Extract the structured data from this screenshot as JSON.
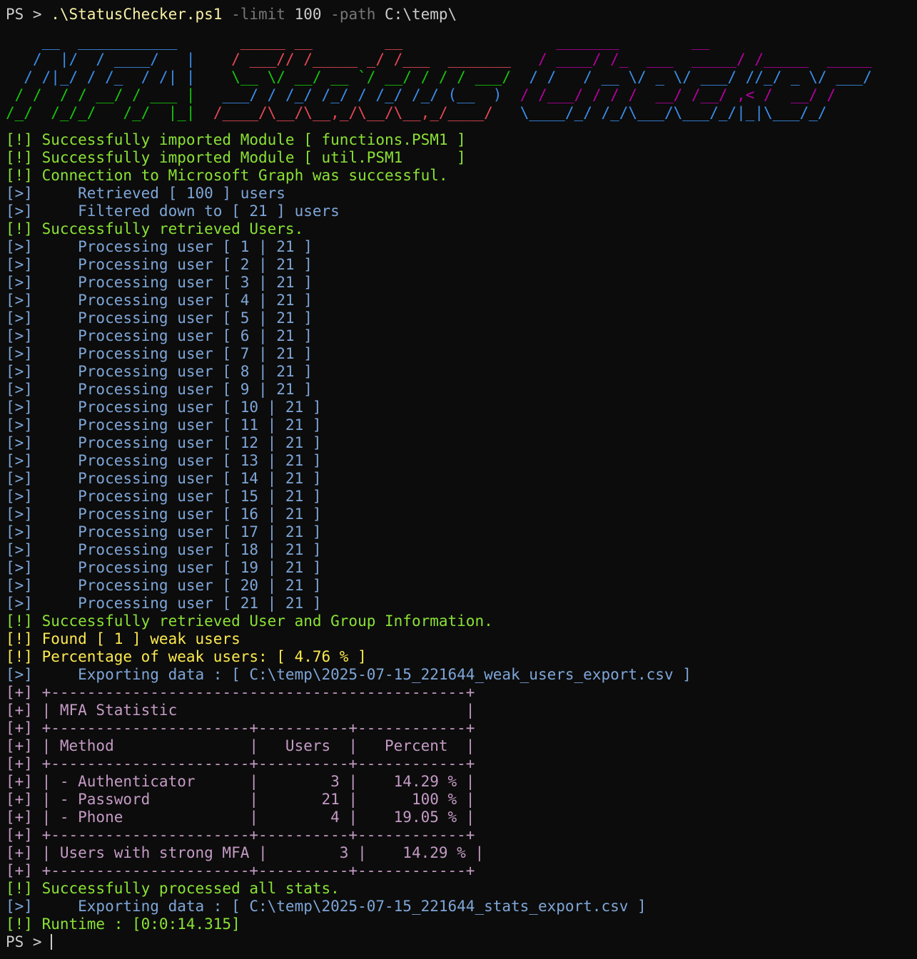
{
  "prompt": {
    "ps": "PS > ",
    "script": ".\\StatusChecker.ps1",
    "arg1_flag": " -limit",
    "arg1_value": " 100",
    "arg2_flag": " -path",
    "arg2_value": " C:\\temp\\",
    "final_ps": "PS > "
  },
  "banner": {
    "lines": [
      [
        {
          "text": "    __  ___________   ",
          "color": "#3b8eea"
        },
        {
          "text": "    ",
          "color": "#cccccc"
        },
        {
          "text": "_____ __        __                 ",
          "color": "#e74856"
        },
        {
          "text": "_______        __",
          "color": "#b4009e"
        }
      ],
      [
        {
          "text": "   /  |/  / ____/   |",
          "color": "#3b8eea"
        },
        {
          "text": "    ",
          "color": "#cccccc"
        },
        {
          "text": "/ ___// /_____ _/ /___  _______   ",
          "color": "#e74856"
        },
        {
          "text": "/ ____/ /_  ___  _____/ /_____  _____",
          "color": "#b4009e"
        }
      ],
      [
        {
          "text": "  / /|_/ / /_  / /| |",
          "color": "#3b8eea"
        },
        {
          "text": "    ",
          "color": "#cccccc"
        },
        {
          "text": "\\__ \\/ __/ __ `/ __/ / / / ___/  ",
          "color": "#16c60c"
        },
        {
          "text": "/ /   / __ \\/ _ \\/ ___/ //_/ _ \\/ ___/",
          "color": "#3b8eea"
        }
      ],
      [
        {
          "text": " / /  / / __/ / ___ |",
          "color": "#16c60c"
        },
        {
          "text": "   ",
          "color": "#cccccc"
        },
        {
          "text": "___/ / /_/ /_/ / /_/ /_/ (__  )  ",
          "color": "#3b8eea"
        },
        {
          "text": "/ /___/ / / /  __/ /__/ ,< /  __/ /",
          "color": "#b4009e"
        }
      ],
      [
        {
          "text": "/_/  /_/_/   /_/  |_|",
          "color": "#16c60c"
        },
        {
          "text": "  ",
          "color": "#cccccc"
        },
        {
          "text": "/____/\\__/\\__,_/\\__/\\__,_/____/   ",
          "color": "#e74856"
        },
        {
          "text": "\\____/_/ /_/\\___/\\___/_/|_|\\___/_/",
          "color": "#3b8eea"
        }
      ]
    ]
  },
  "log": [
    {
      "text": "[!] Successfully imported Module [ functions.PSM1 ]",
      "color": "#8ae234"
    },
    {
      "text": "[!] Successfully imported Module [ util.PSM1      ]",
      "color": "#8ae234"
    },
    {
      "text": "[!] Connection to Microsoft Graph was successful.",
      "color": "#8ae234"
    },
    {
      "text": "[>]     Retrieved [ 100 ] users",
      "color": "#7ea6d8"
    },
    {
      "text": "[>]     Filtered down to [ 21 ] users",
      "color": "#7ea6d8"
    },
    {
      "text": "[!] Successfully retrieved Users.",
      "color": "#8ae234"
    },
    {
      "text": "[>]     Processing user [ 1 | 21 ]",
      "color": "#7ea6d8"
    },
    {
      "text": "[>]     Processing user [ 2 | 21 ]",
      "color": "#7ea6d8"
    },
    {
      "text": "[>]     Processing user [ 3 | 21 ]",
      "color": "#7ea6d8"
    },
    {
      "text": "[>]     Processing user [ 4 | 21 ]",
      "color": "#7ea6d8"
    },
    {
      "text": "[>]     Processing user [ 5 | 21 ]",
      "color": "#7ea6d8"
    },
    {
      "text": "[>]     Processing user [ 6 | 21 ]",
      "color": "#7ea6d8"
    },
    {
      "text": "[>]     Processing user [ 7 | 21 ]",
      "color": "#7ea6d8"
    },
    {
      "text": "[>]     Processing user [ 8 | 21 ]",
      "color": "#7ea6d8"
    },
    {
      "text": "[>]     Processing user [ 9 | 21 ]",
      "color": "#7ea6d8"
    },
    {
      "text": "[>]     Processing user [ 10 | 21 ]",
      "color": "#7ea6d8"
    },
    {
      "text": "[>]     Processing user [ 11 | 21 ]",
      "color": "#7ea6d8"
    },
    {
      "text": "[>]     Processing user [ 12 | 21 ]",
      "color": "#7ea6d8"
    },
    {
      "text": "[>]     Processing user [ 13 | 21 ]",
      "color": "#7ea6d8"
    },
    {
      "text": "[>]     Processing user [ 14 | 21 ]",
      "color": "#7ea6d8"
    },
    {
      "text": "[>]     Processing user [ 15 | 21 ]",
      "color": "#7ea6d8"
    },
    {
      "text": "[>]     Processing user [ 16 | 21 ]",
      "color": "#7ea6d8"
    },
    {
      "text": "[>]     Processing user [ 17 | 21 ]",
      "color": "#7ea6d8"
    },
    {
      "text": "[>]     Processing user [ 18 | 21 ]",
      "color": "#7ea6d8"
    },
    {
      "text": "[>]     Processing user [ 19 | 21 ]",
      "color": "#7ea6d8"
    },
    {
      "text": "[>]     Processing user [ 20 | 21 ]",
      "color": "#7ea6d8"
    },
    {
      "text": "[>]     Processing user [ 21 | 21 ]",
      "color": "#7ea6d8"
    },
    {
      "text": "[!] Successfully retrieved User and Group Information.",
      "color": "#8ae234"
    },
    {
      "text": "[!] Found [ 1 ] weak users",
      "color": "#fce94f"
    },
    {
      "text": "[!] Percentage of weak users: [ 4.76 % ]",
      "color": "#fce94f"
    },
    {
      "text": "[>]     Exporting data : [ C:\\temp\\2025-07-15_221644_weak_users_export.csv ]",
      "color": "#7ea6d8"
    },
    {
      "text": "[+] +----------------------------------------------+",
      "color": "#c49bc4"
    },
    {
      "text": "[+] | MFA Statistic                                |",
      "color": "#c49bc4"
    },
    {
      "text": "[+] +----------------------+----------+------------+",
      "color": "#c49bc4"
    },
    {
      "text": "[+] | Method               |   Users  |   Percent  |",
      "color": "#c49bc4"
    },
    {
      "text": "[+] +----------------------+----------+------------+",
      "color": "#c49bc4"
    },
    {
      "text": "[+] | - Authenticator      |        3 |    14.29 % |",
      "color": "#c49bc4"
    },
    {
      "text": "[+] | - Password           |       21 |      100 % |",
      "color": "#c49bc4"
    },
    {
      "text": "[+] | - Phone              |        4 |    19.05 % |",
      "color": "#c49bc4"
    },
    {
      "text": "[+] +----------------------+----------+------------+",
      "color": "#c49bc4"
    },
    {
      "text": "[+] | Users with strong MFA |        3 |    14.29 % |",
      "color": "#c49bc4"
    },
    {
      "text": "[+] +----------------------+----------+------------+",
      "color": "#c49bc4"
    },
    {
      "text": "[!] Successfully processed all stats.",
      "color": "#8ae234"
    },
    {
      "text": "[>]     Exporting data : [ C:\\temp\\2025-07-15_221644_stats_export.csv ]",
      "color": "#7ea6d8"
    },
    {
      "text": "[!] Runtime : [0:0:14.315]",
      "color": "#8ae234"
    }
  ]
}
